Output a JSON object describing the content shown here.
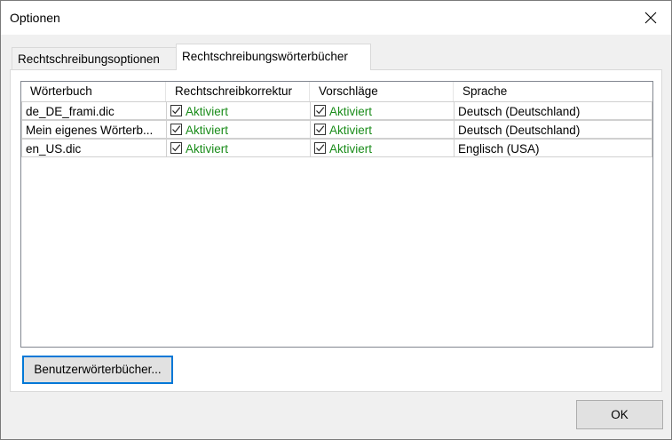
{
  "window": {
    "title": "Optionen"
  },
  "tabs": [
    {
      "label": "Rechtschreibungsoptionen"
    },
    {
      "label": "Rechtschreibungswörterbücher"
    }
  ],
  "table": {
    "columns": [
      "Wörterbuch",
      "Rechtschreibkorrektur",
      "Vorschläge",
      "Sprache"
    ],
    "rows": [
      {
        "dictionary": "de_DE_frami.dic",
        "spellcheck": "Aktiviert",
        "suggestions": "Aktiviert",
        "language": "Deutsch (Deutschland)"
      },
      {
        "dictionary": "Mein eigenes Wörterb...",
        "spellcheck": "Aktiviert",
        "suggestions": "Aktiviert",
        "language": "Deutsch (Deutschland)"
      },
      {
        "dictionary": "en_US.dic",
        "spellcheck": "Aktiviert",
        "suggestions": "Aktiviert",
        "language": "Englisch (USA)"
      }
    ]
  },
  "buttons": {
    "user_dictionaries": "Benutzerwörterbücher...",
    "ok": "OK"
  },
  "colors": {
    "enabled_text": "#1a8c1a",
    "focus_border": "#0078d7"
  }
}
